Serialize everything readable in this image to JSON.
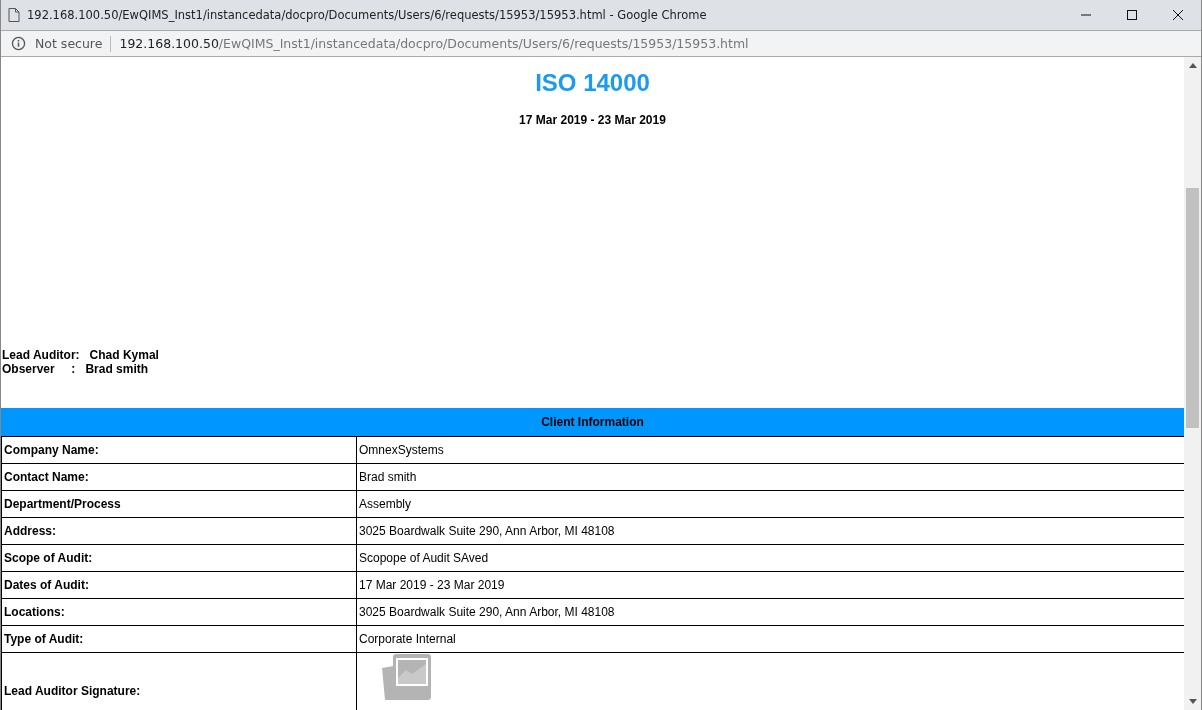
{
  "window": {
    "title": "192.168.100.50/EwQIMS_Inst1/instancedata/docpro/Documents/Users/6/requests/15953/15953.html - Google Chrome"
  },
  "address_bar": {
    "security": "Not secure",
    "host": "192.168.100.50",
    "path": "/EwQIMS_Inst1/instancedata/docpro/Documents/Users/6/requests/15953/15953.html"
  },
  "document": {
    "title": "ISO 14000",
    "dates": "17 Mar 2019 - 23 Mar 2019",
    "people": [
      {
        "label": "Lead Auditor:",
        "name": "Chad Kymal"
      },
      {
        "label": "Observer     :",
        "name": "Brad smith"
      }
    ],
    "section_title": "Client Information",
    "rows": [
      {
        "kind": "text",
        "label": "Company Name:",
        "value": "OmnexSystems"
      },
      {
        "kind": "text",
        "label": "Contact Name:",
        "value": "Brad smith"
      },
      {
        "kind": "text",
        "label": "Department/Process",
        "value": "Assembly"
      },
      {
        "kind": "text",
        "label": "Address:",
        "value": "3025 Boardwalk Suite 290, Ann Arbor, MI 48108"
      },
      {
        "kind": "text",
        "label": "Scope of Audit:",
        "value": "Scopope of Audit SAved"
      },
      {
        "kind": "text",
        "label": "Dates of Audit:",
        "value": "17 Mar 2019 - 23 Mar 2019"
      },
      {
        "kind": "text",
        "label": "Locations:",
        "value": "3025 Boardwalk Suite 290, Ann Arbor, MI 48108"
      },
      {
        "kind": "text",
        "label": "Type of Audit:",
        "value": "Corporate Internal"
      },
      {
        "kind": "signature",
        "label": "Lead Auditor Signature:"
      }
    ]
  }
}
